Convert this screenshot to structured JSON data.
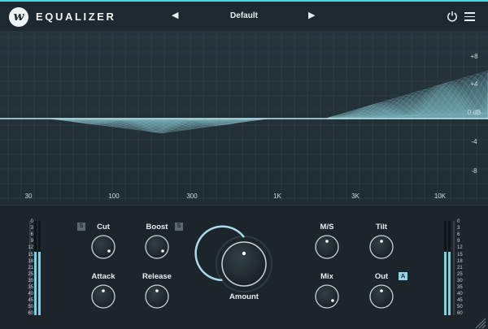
{
  "app": {
    "logo_letter": "w",
    "title": "EQUALIZER"
  },
  "preset": {
    "prev_icon": "◀",
    "name": "Default",
    "next_icon": "▶"
  },
  "header_icons": [
    "power-icon",
    "menu-icon"
  ],
  "graph": {
    "db_labels": [
      "+8",
      "+4",
      "0 dB",
      "-4",
      "-8"
    ],
    "freq_labels": [
      "30",
      "100",
      "300",
      "1K",
      "3K",
      "10K"
    ]
  },
  "controls": {
    "cut": "Cut",
    "boost": "Boost",
    "attack": "Attack",
    "release": "Release",
    "amount": "Amount",
    "ms": "M/S",
    "tilt": "Tilt",
    "mix": "Mix",
    "out": "Out",
    "s_badge": "S",
    "a_badge": "A"
  },
  "meter": {
    "scale": [
      "0",
      "3",
      "6",
      "9",
      "12",
      "15",
      "18",
      "21",
      "25",
      "30",
      "35",
      "40",
      "45",
      "50",
      "60"
    ]
  },
  "colors": {
    "accent": "#4fd6e6",
    "background": "#1f2a31",
    "panel": "#1c252c"
  }
}
